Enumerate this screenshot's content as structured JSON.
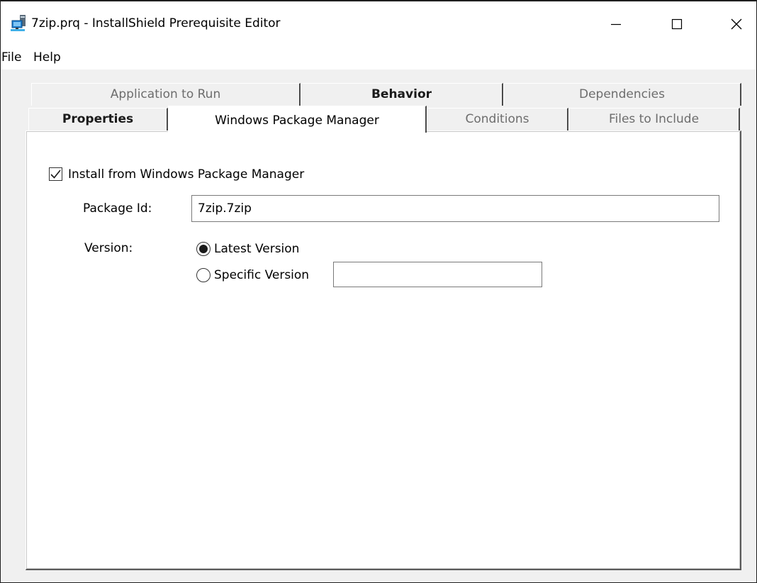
{
  "window": {
    "title": "7zip.prq - InstallShield Prerequisite Editor",
    "icon": "computer-network-icon"
  },
  "menu": {
    "items": [
      {
        "label": "File"
      },
      {
        "label": "Help"
      }
    ]
  },
  "tabs": {
    "back_row": [
      {
        "label": "Application to Run",
        "bold": false
      },
      {
        "label": "Behavior",
        "bold": true
      },
      {
        "label": "Dependencies",
        "bold": false
      }
    ],
    "front_row": [
      {
        "label": "Properties",
        "bold": true
      },
      {
        "label": "Windows Package Manager",
        "active": true
      },
      {
        "label": "Conditions",
        "bold": false
      },
      {
        "label": "Files to Include",
        "bold": false
      }
    ]
  },
  "form": {
    "install_checkbox": {
      "label": "Install from Windows Package Manager",
      "checked": true
    },
    "package_id": {
      "label": "Package Id:",
      "value": "7zip.7zip"
    },
    "version": {
      "label": "Version:",
      "options": [
        {
          "label": "Latest Version",
          "selected": true
        },
        {
          "label": "Specific Version",
          "selected": false
        }
      ],
      "specific_value": ""
    }
  }
}
